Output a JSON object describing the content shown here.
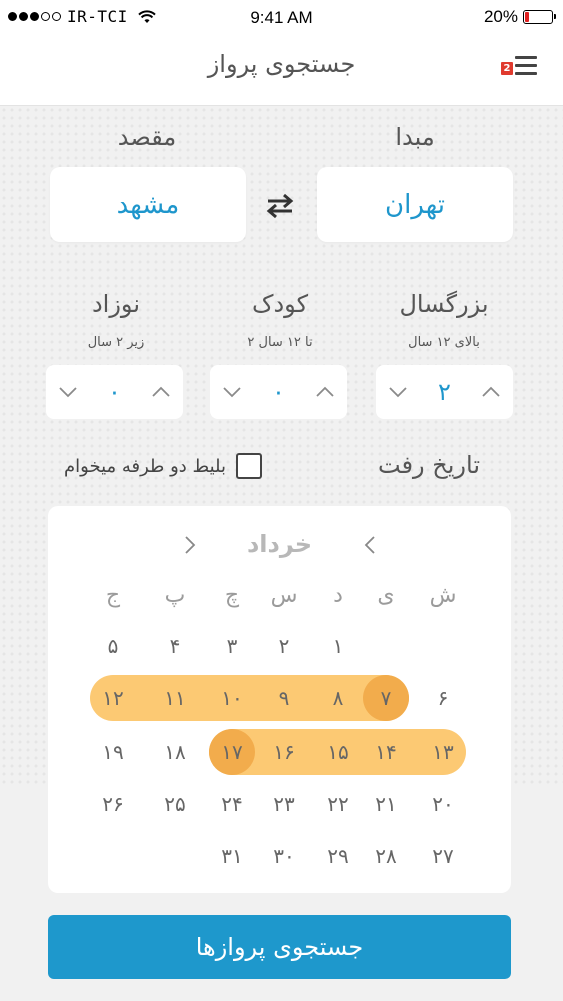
{
  "status_bar": {
    "carrier": "IR-TCI",
    "time": "9:41 AM",
    "battery": "20%",
    "signal_bars_filled": 3,
    "signal_bars_total": 5
  },
  "header": {
    "title": "جستجوی پرواز",
    "menu_badge": "2"
  },
  "route": {
    "origin_label": "مبدا",
    "origin_value": "تهران",
    "destination_label": "مقصد",
    "destination_value": "مشهد"
  },
  "passengers": {
    "adult": {
      "title": "بزرگسال",
      "sub": "بالای ۱۲ سال",
      "value": "۲"
    },
    "child": {
      "title": "کودک",
      "sub": "۲ تا ۱۲ سال",
      "value": "۰"
    },
    "infant": {
      "title": "نوزاد",
      "sub": "زیر ۲ سال",
      "value": "۰"
    }
  },
  "departure_label": "تاریخ رفت",
  "round_trip_label": "بلیط دو طرفه میخوام",
  "round_trip_checked": false,
  "calendar": {
    "month": "خرداد",
    "weekdays": [
      "ش",
      "ی",
      "د",
      "س",
      "چ",
      "پ",
      "ج"
    ],
    "weeks": [
      [
        "",
        "",
        "۱",
        "۲",
        "۳",
        "۴",
        "۵"
      ],
      [
        "۶",
        "۷",
        "۸",
        "۹",
        "۱۰",
        "۱۱",
        "۱۲"
      ],
      [
        "۱۳",
        "۱۴",
        "۱۵",
        "۱۶",
        "۱۷",
        "۱۸",
        "۱۹"
      ],
      [
        "۲۰",
        "۲۱",
        "۲۲",
        "۲۳",
        "۲۴",
        "۲۵",
        "۲۶"
      ],
      [
        "۲۷",
        "۲۸",
        "۲۹",
        "۳۰",
        "۳۱",
        "",
        ""
      ]
    ],
    "selected_start": "۷",
    "selected_end": "۱۷",
    "range_color": "#fcc973",
    "endpoint_color": "#f2ac4c"
  },
  "search_button": "جستجوی پروازها",
  "colors": {
    "accent": "#1e98cc",
    "value_text": "#1e96cc"
  }
}
